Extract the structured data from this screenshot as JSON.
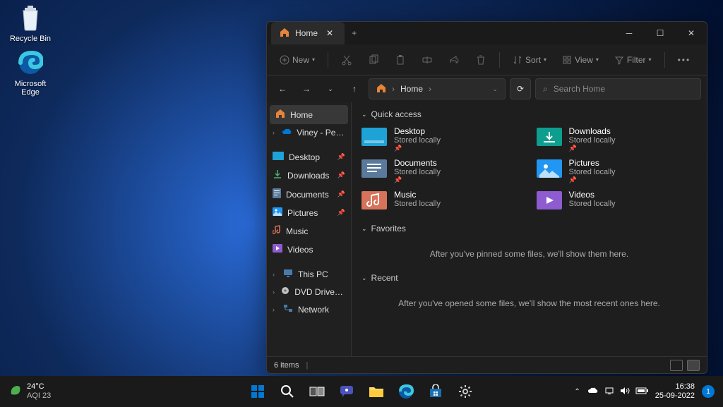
{
  "desktop": {
    "icons": [
      {
        "name": "Recycle Bin"
      },
      {
        "name": "Microsoft Edge"
      }
    ]
  },
  "explorer": {
    "tab_title": "Home",
    "toolbar": {
      "new": "New",
      "sort": "Sort",
      "view": "View",
      "filter": "Filter"
    },
    "breadcrumb": "Home",
    "search_placeholder": "Search Home",
    "sidebar": {
      "home": "Home",
      "personal": "Viney - Personal",
      "desktop": "Desktop",
      "downloads": "Downloads",
      "documents": "Documents",
      "pictures": "Pictures",
      "music": "Music",
      "videos": "Videos",
      "thispc": "This PC",
      "dvd": "DVD Drive (D:) CCC",
      "network": "Network"
    },
    "sections": {
      "quick_access": "Quick access",
      "favorites": "Favorites",
      "recent": "Recent"
    },
    "qa_items": [
      {
        "name": "Desktop",
        "sub": "Stored locally",
        "pinned": true,
        "color": "#1fa2d6"
      },
      {
        "name": "Downloads",
        "sub": "Stored locally",
        "pinned": true,
        "color": "#0e9e8f"
      },
      {
        "name": "Documents",
        "sub": "Stored locally",
        "pinned": true,
        "color": "#5b7a9b"
      },
      {
        "name": "Pictures",
        "sub": "Stored locally",
        "pinned": true,
        "color": "#2196f3"
      },
      {
        "name": "Music",
        "sub": "Stored locally",
        "pinned": false,
        "color": "#d6735a"
      },
      {
        "name": "Videos",
        "sub": "Stored locally",
        "pinned": false,
        "color": "#8e5bd0"
      }
    ],
    "favorites_empty": "After you've pinned some files, we'll show them here.",
    "recent_empty": "After you've opened some files, we'll show the most recent ones here.",
    "status_items": "6 items"
  },
  "taskbar": {
    "temp": "24°C",
    "aqi": "AQI 23",
    "time": "16:38",
    "date": "25-09-2022",
    "notif_count": "1"
  }
}
